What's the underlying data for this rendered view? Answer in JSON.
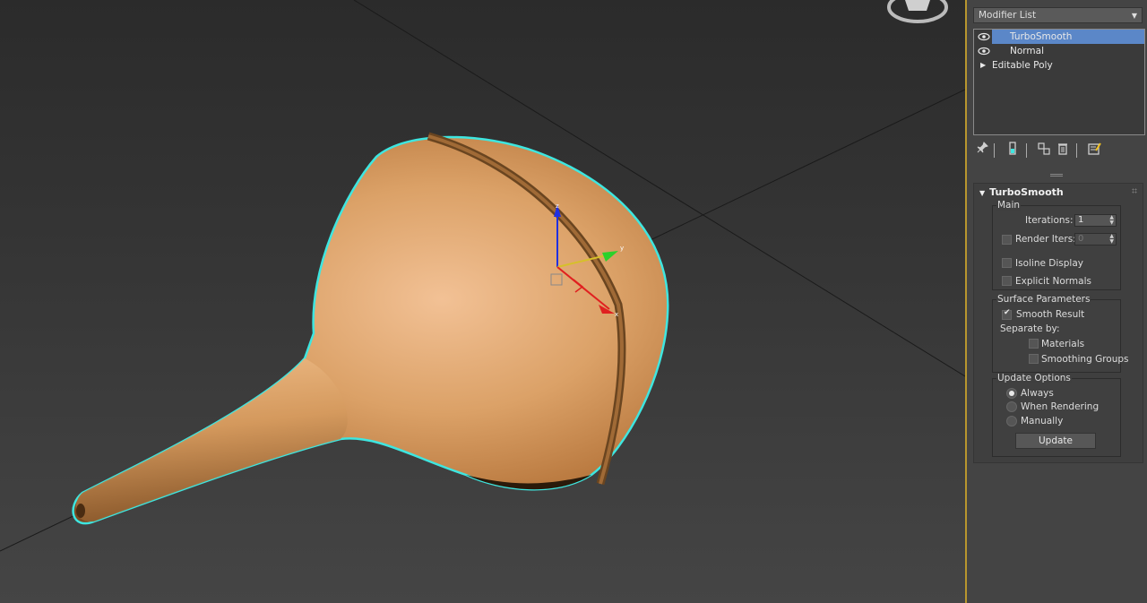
{
  "panel": {
    "modifier_list_label": "Modifier List",
    "stack": [
      {
        "label": "TurboSmooth",
        "selected": true,
        "visible_icon": "eye-icon"
      },
      {
        "label": "Normal",
        "selected": false,
        "visible_icon": "eye-icon"
      },
      {
        "label": "Editable Poly",
        "selected": false,
        "expand_icon": "expand-triangle-icon"
      }
    ],
    "tools": [
      "pin-stack-icon",
      "show-end-result-icon",
      "make-unique-icon",
      "remove-modifier-icon",
      "configure-modifier-sets-icon"
    ]
  },
  "turbosmooth": {
    "title": "TurboSmooth",
    "main": {
      "title": "Main",
      "iterations_label": "Iterations:",
      "iterations_value": "1",
      "render_iters_label": "Render Iters:",
      "render_iters_value": "0",
      "render_iters_checked": false,
      "isoline_label": "Isoline Display",
      "isoline_checked": false,
      "explicit_normals_label": "Explicit Normals",
      "explicit_normals_checked": false
    },
    "surface": {
      "title": "Surface Parameters",
      "smooth_result_label": "Smooth Result",
      "smooth_result_checked": true,
      "separate_by_label": "Separate by:",
      "materials_label": "Materials",
      "materials_checked": false,
      "smoothing_groups_label": "Smoothing Groups",
      "smoothing_groups_checked": false
    },
    "update": {
      "title": "Update Options",
      "options": [
        "Always",
        "When Rendering",
        "Manually"
      ],
      "selected": "Always",
      "button_label": "Update"
    }
  },
  "viewport": {
    "gizmo_axes": {
      "x": "x",
      "y": "y",
      "z": "z"
    },
    "colors": {
      "selection_outline": "#3ee6e0",
      "object": "#d89a5e",
      "x_axis": "#e02020",
      "y_axis": "#2bd12b",
      "z_axis": "#2030e0"
    }
  }
}
